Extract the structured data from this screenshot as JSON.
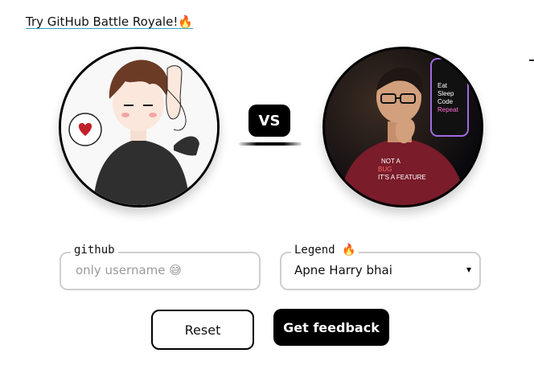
{
  "header": {
    "link_text": "Try GitHub Battle Royale!",
    "link_emoji": "🔥"
  },
  "avatars": {
    "left": {
      "name": "anime-avatar",
      "icon": "heart-icon"
    },
    "right": {
      "name": "harry-avatar",
      "tshirt_text": "NOT A BUG IT'S A FEATURE",
      "phone_text": "Eat Sleep Code Repeat"
    }
  },
  "versus": {
    "label": "VS"
  },
  "form": {
    "github": {
      "label": "github",
      "placeholder": "only username 😅",
      "value": ""
    },
    "legend": {
      "label": "Legend 🔥",
      "selected": "Apne Harry bhai"
    }
  },
  "buttons": {
    "reset": "Reset",
    "feedback": "Get feedback"
  },
  "colors": {
    "primary": "#000000",
    "border": "#cfcfcf",
    "link_underline": "#2aa3c9"
  }
}
